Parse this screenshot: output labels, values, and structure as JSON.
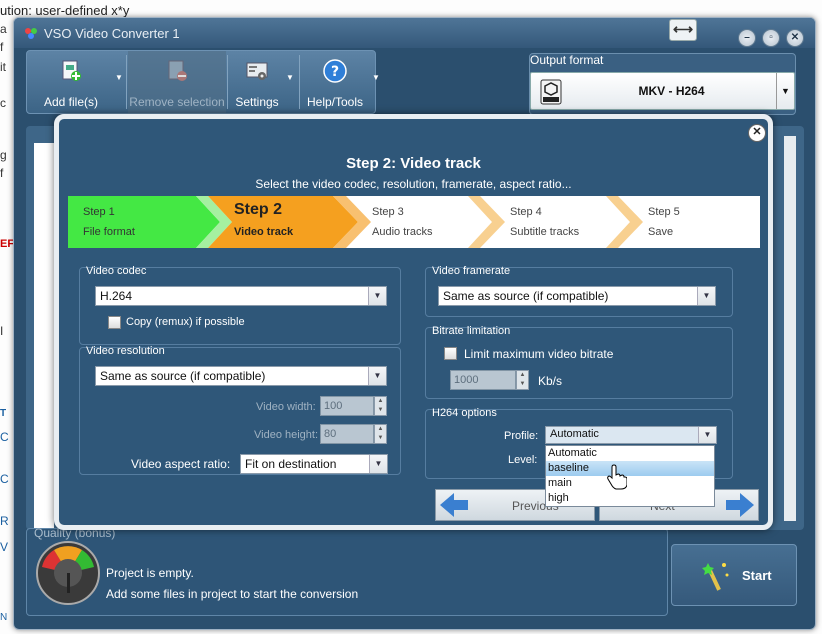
{
  "background": {
    "top_text": "ution: user-defined x*y",
    "left_fragments": [
      "a",
      "f",
      "it",
      "c",
      "g",
      "f",
      "EF",
      "I",
      "T",
      "C",
      "C",
      "R",
      "V",
      "N"
    ]
  },
  "window": {
    "title": "VSO Video Converter 1",
    "resize_glyph": "⟷",
    "controls": {
      "minimize": "–",
      "maximize": "▫",
      "close": "✕"
    }
  },
  "toolbar": {
    "add_files": "Add file(s)",
    "remove_selection": "Remove selection",
    "settings": "Settings",
    "help_tools": "Help/Tools",
    "arrow": "▼"
  },
  "output_format": {
    "label": "Output format",
    "value": "MKV - H264",
    "arrow": "▼"
  },
  "quality": {
    "label": "Quality (bonus)",
    "status_line1": "Project is empty.",
    "status_line2": "Add some files in project to start the conversion"
  },
  "start": {
    "label": "Start"
  },
  "dialog": {
    "close": "✕",
    "title": "Step 2: Video track",
    "subtitle": "Select the video codec, resolution, framerate, aspect ratio...",
    "steps": [
      {
        "line1": "Step 1",
        "line2": "File format"
      },
      {
        "line1": "Step 2",
        "line2": "Video track"
      },
      {
        "line1": "Step 3",
        "line2": "Audio tracks"
      },
      {
        "line1": "Step 4",
        "line2": "Subtitle tracks"
      },
      {
        "line1": "Step 5",
        "line2": "Save"
      }
    ],
    "video_codec": {
      "label": "Video codec",
      "value": "H.264",
      "copy_remux_label": "Copy (remux) if possible"
    },
    "video_resolution": {
      "label": "Video resolution",
      "value": "Same as source (if compatible)",
      "width_label": "Video width:",
      "width_value": "100",
      "height_label": "Video height:",
      "height_value": "80",
      "aspect_label": "Video aspect ratio:",
      "aspect_value": "Fit on destination"
    },
    "video_framerate": {
      "label": "Video framerate",
      "value": "Same as source (if compatible)"
    },
    "bitrate": {
      "label": "Bitrate limitation",
      "limit_label": "Limit maximum video bitrate",
      "value": "1000",
      "unit": "Kb/s"
    },
    "h264": {
      "label": "H264 options",
      "profile_label": "Profile:",
      "profile_value": "Automatic",
      "profile_options": [
        "Automatic",
        "baseline",
        "main",
        "high"
      ],
      "highlighted_option": "baseline",
      "level_label": "Level:"
    },
    "nav": {
      "previous": "Previous",
      "next": "Next"
    }
  },
  "colors": {
    "window_bg": "#2b4f6e",
    "dialog_bg": "#2f5779",
    "step_done": "#44e844",
    "step_active": "#f5a01f",
    "highlight": "#9ccbef"
  },
  "icons": [
    "add-files-icon",
    "remove-selection-icon",
    "settings-icon",
    "help-icon",
    "mkv-icon",
    "gauge-icon",
    "start-wand-icon",
    "hand-cursor-icon"
  ]
}
